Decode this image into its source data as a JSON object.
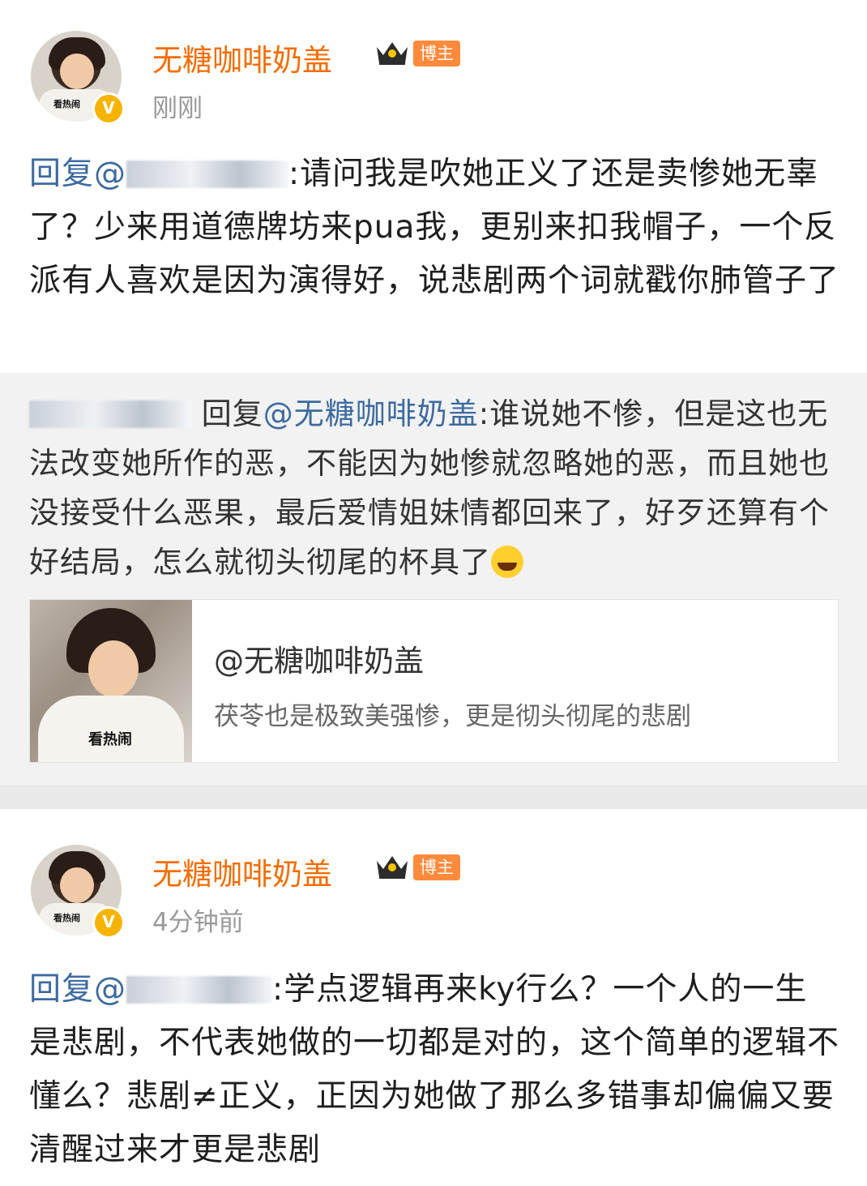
{
  "post1": {
    "username": "无糖咖啡奶盖",
    "badge": "博主",
    "verified": "V",
    "time": "刚刚",
    "avatar_caption": "看热闹",
    "reply_prefix": "回复@",
    "reply_suffix": ":请问我是吹她正义了还是卖惨她无辜了？少来用道德牌坊来pua我，更别来扣我帽子，一个反派有人喜欢是因为演得好，说悲剧两个词就戳你肺管子了"
  },
  "quote": {
    "reply_label": "回复",
    "mention": "@无糖咖啡奶盖",
    "text": ":谁说她不惨，但是这也无法改变她所作的恶，不能因为她惨就忽略她的恶，而且她也没接受什么恶果，最后爱情姐妹情都回来了，好歹还算有个好结局，怎么就彻头彻尾的杯具了",
    "emoji": "laugh-cry-emoji",
    "card": {
      "title": "@无糖咖啡奶盖",
      "subtitle": "茯苓也是极致美强惨，更是彻头彻尾的悲剧",
      "image_caption": "看热闹"
    }
  },
  "post2": {
    "username": "无糖咖啡奶盖",
    "badge": "博主",
    "verified": "V",
    "time": "4分钟前",
    "avatar_caption": "看热闹",
    "reply_prefix": "回复@",
    "reply_suffix": ":学点逻辑再来ky行么？一个人的一生是悲剧，不代表她做的一切都是对的，这个简单的逻辑不懂么？悲剧≠正义，正因为她做了那么多错事却偏偏又要清醒过来才更是悲剧"
  },
  "colors": {
    "username": "#f56c00",
    "mention": "#3d6aa0",
    "badge": "#ff8a3c",
    "verified": "#f6b400"
  }
}
